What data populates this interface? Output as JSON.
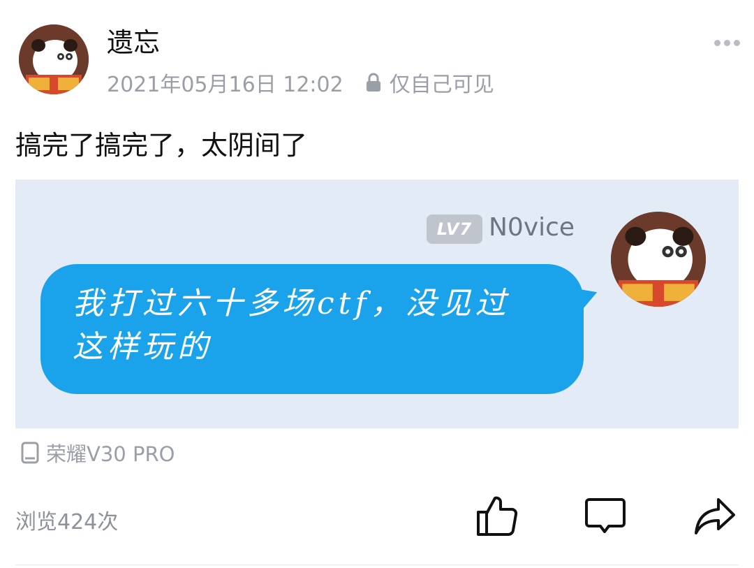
{
  "header": {
    "username": "遗忘",
    "timestamp": "2021年05月16日 12:02",
    "visibility": "仅自己可见",
    "visibility_icon": "lock-icon",
    "more_icon": "more-dots-icon"
  },
  "post": {
    "text": "搞完了搞完了，太阴间了"
  },
  "image": {
    "level_badge": "LV7",
    "nickname": "N0vice",
    "message_line1": "我打过六十多场ctf，没见过",
    "message_line2": "这样玩的",
    "bubble_color": "#1aa3eb"
  },
  "device": {
    "icon": "phone-icon",
    "label": "荣耀V30 PRO"
  },
  "footer": {
    "views": "浏览424次",
    "like_icon": "thumbs-up-icon",
    "comment_icon": "comment-icon",
    "share_icon": "share-icon"
  }
}
